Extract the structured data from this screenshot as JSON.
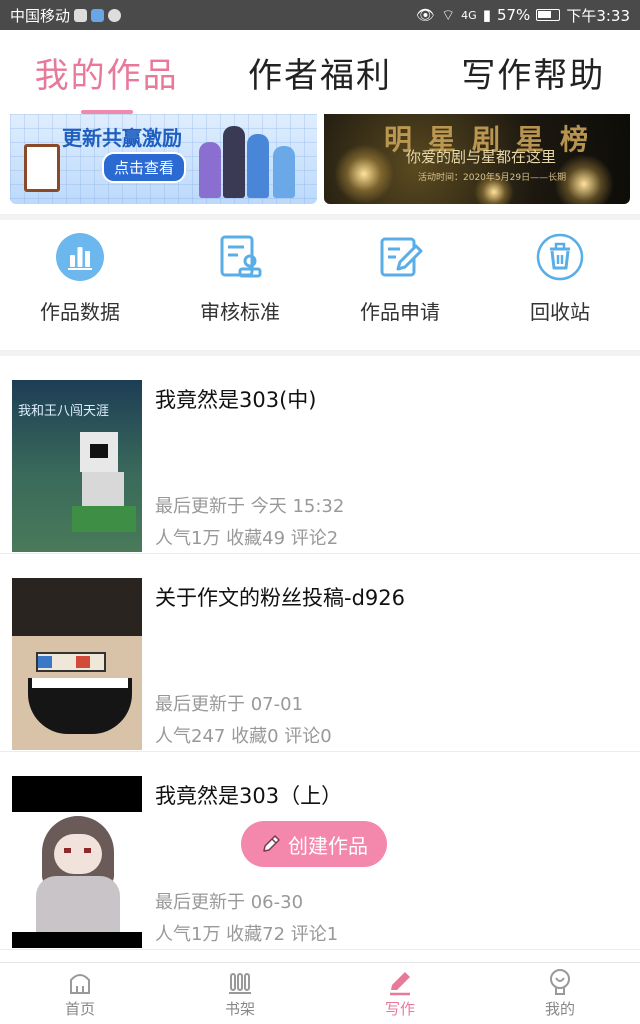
{
  "status_bar": {
    "carrier": "中国移动",
    "network": "4G",
    "battery": "57%",
    "time": "下午3:33"
  },
  "tabs": [
    {
      "label": "我的作品",
      "active": true
    },
    {
      "label": "作者福利",
      "active": false
    },
    {
      "label": "写作帮助",
      "active": false
    }
  ],
  "banners": {
    "left": {
      "title": "更新共赢激励",
      "button": "点击查看"
    },
    "right": {
      "headline": "明星剧星榜",
      "subtitle": "你爱的剧与星都在这里",
      "date_note": "活动时间：2020年5月29日——长期"
    }
  },
  "quick_actions": [
    {
      "label": "作品数据",
      "icon": "bar-chart-icon"
    },
    {
      "label": "审核标准",
      "icon": "review-standard-icon"
    },
    {
      "label": "作品申请",
      "icon": "edit-document-icon"
    },
    {
      "label": "回收站",
      "icon": "trash-icon"
    }
  ],
  "works": [
    {
      "title": "我竟然是303(中)",
      "updated": "最后更新于 今天 15:32",
      "stats": "人气1万 收藏49 评论2",
      "cover_text": "我和王八闯天涯"
    },
    {
      "title": "关于作文的粉丝投稿-d926",
      "updated": "最后更新于 07-01",
      "stats": "人气247 收藏0 评论0",
      "cover_text": ""
    },
    {
      "title": "我竟然是303（上）",
      "updated": "最后更新于 06-30",
      "stats": "人气1万 收藏72 评论1",
      "cover_text": ""
    }
  ],
  "create_button": {
    "label": "创建作品"
  },
  "bottom_nav": [
    {
      "label": "首页",
      "icon": "home-icon",
      "active": false
    },
    {
      "label": "书架",
      "icon": "bookshelf-icon",
      "active": false
    },
    {
      "label": "写作",
      "icon": "pen-icon",
      "active": true
    },
    {
      "label": "我的",
      "icon": "profile-icon",
      "active": false
    }
  ],
  "colors": {
    "accent": "#e8799a",
    "icon_blue": "#5aaee8"
  }
}
